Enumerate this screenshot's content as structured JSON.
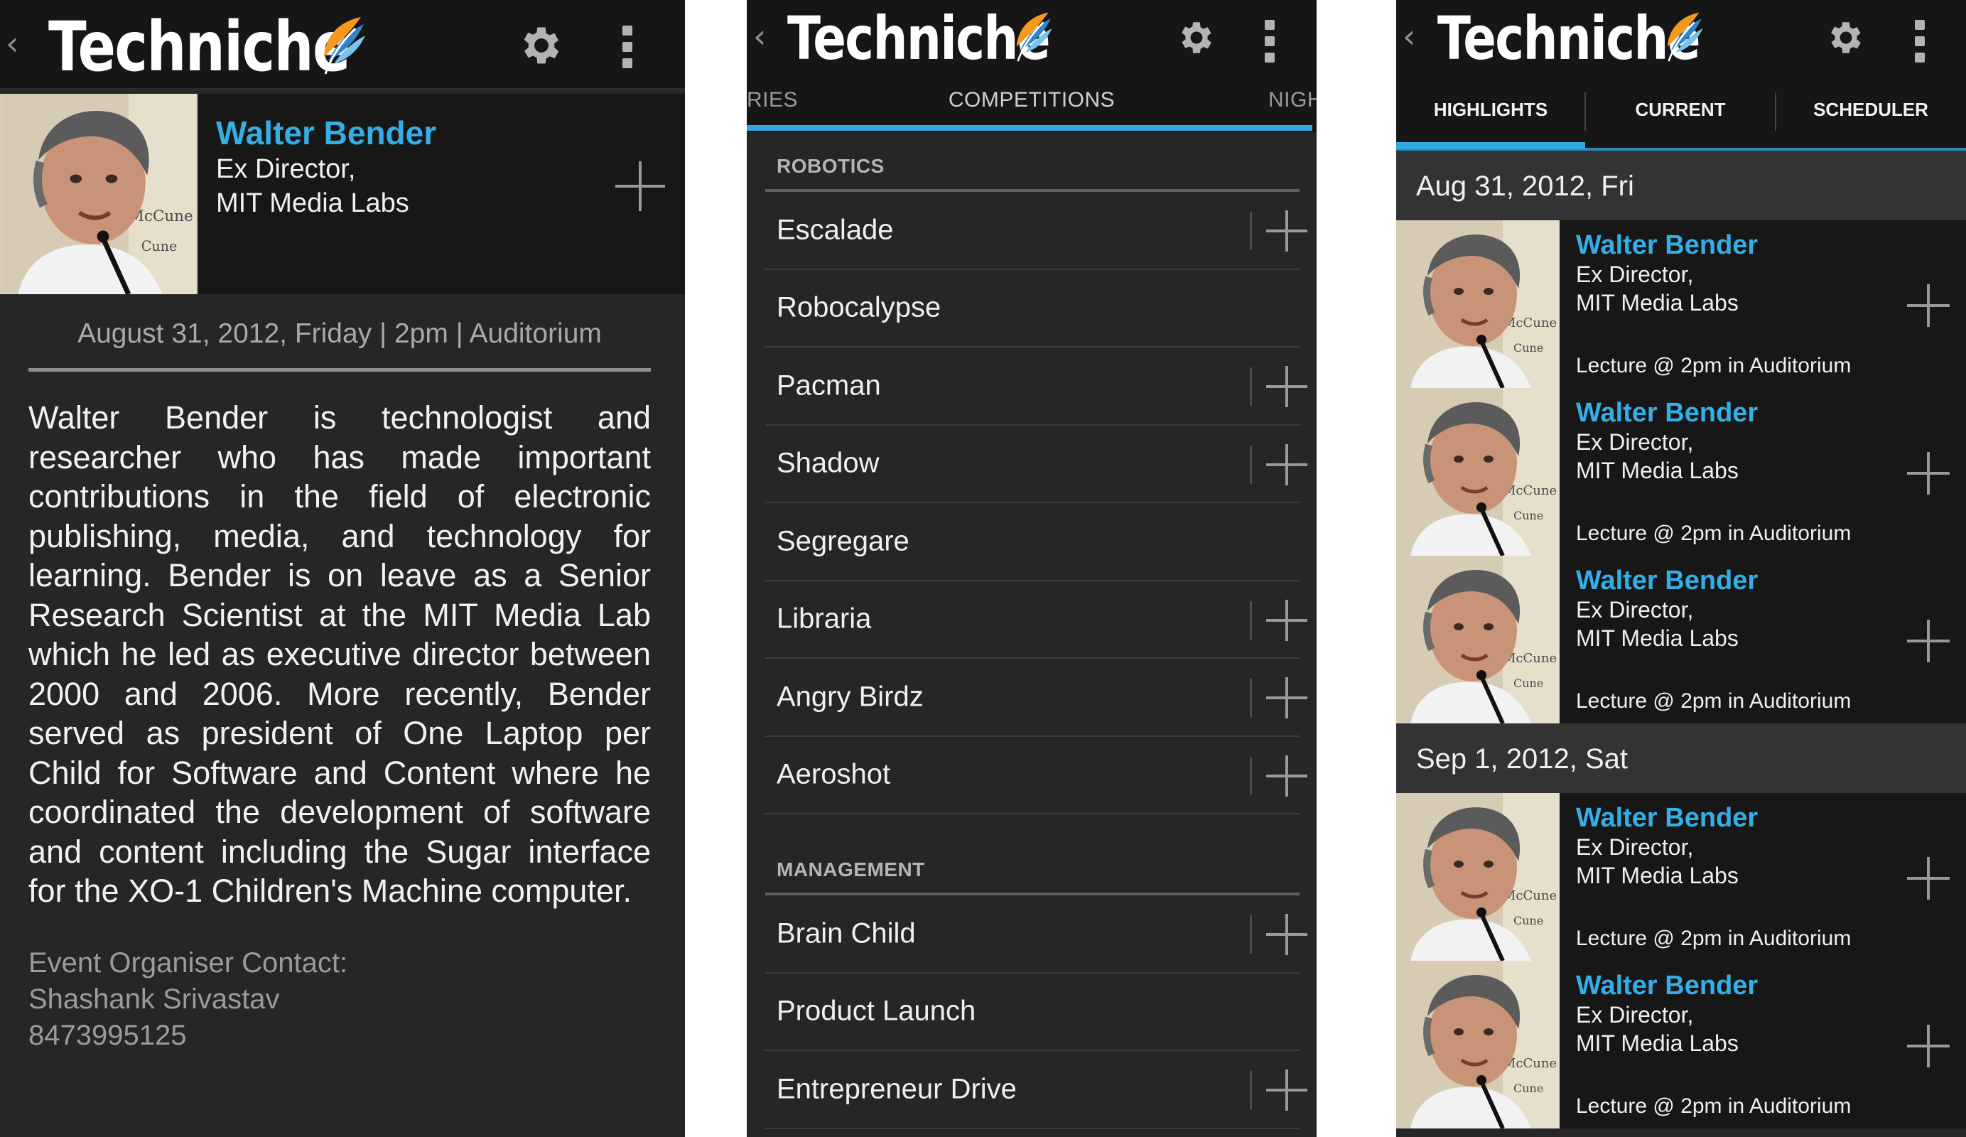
{
  "app": {
    "brand": "Techniche",
    "back_glyph": "‹"
  },
  "detail": {
    "speaker": {
      "name": "Walter Bender",
      "role_line1": "Ex Director,",
      "role_line2": "MIT Media Labs"
    },
    "event_line": "August 31, 2012, Friday | 2pm | Auditorium",
    "bio": "Walter Bender is technologist and researcher who has made important contributions in the field of electronic publishing, media, and technology for learning. Bender is on leave as a Senior Research Scientist at the MIT Media Lab which he led as executive director between 2000 and 2006. More recently, Bender served as president of One Laptop per Child for Software and Content where he coordinated the development of software and content including the Sugar interface for the XO-1 Children's Machine computer.",
    "contact": {
      "label": "Event Organiser Contact:",
      "name": "Shashank Srivastav",
      "phone": "8473995125"
    }
  },
  "competitions": {
    "tabs": {
      "left": "RIES",
      "center": "COMPETITIONS",
      "right": "NIGH"
    },
    "sections": [
      {
        "title": "ROBOTICS",
        "items": [
          {
            "label": "Escalade",
            "has_add": true
          },
          {
            "label": "Robocalypse",
            "has_add": false
          },
          {
            "label": "Pacman",
            "has_add": true
          },
          {
            "label": "Shadow",
            "has_add": true
          },
          {
            "label": "Segregare",
            "has_add": false
          },
          {
            "label": "Libraria",
            "has_add": true
          },
          {
            "label": "Angry Birdz",
            "has_add": true
          },
          {
            "label": "Aeroshot",
            "has_add": true
          }
        ]
      },
      {
        "title": "MANAGEMENT",
        "items": [
          {
            "label": "Brain Child",
            "has_add": true
          },
          {
            "label": "Product Launch",
            "has_add": false
          },
          {
            "label": "Entrepreneur Drive",
            "has_add": true
          }
        ]
      }
    ]
  },
  "schedule": {
    "tabs": [
      "HIGHLIGHTS",
      "CURRENT",
      "SCHEDULER"
    ],
    "days": [
      {
        "label": "Aug 31, 2012, Fri",
        "events": [
          {
            "name": "Walter Bender",
            "role_line1": "Ex Director,",
            "role_line2": "MIT Media Labs",
            "time": "Lecture @ 2pm in Auditorium"
          },
          {
            "name": "Walter Bender",
            "role_line1": "Ex Director,",
            "role_line2": "MIT Media Labs",
            "time": "Lecture @ 2pm in Auditorium"
          },
          {
            "name": "Walter Bender",
            "role_line1": "Ex Director,",
            "role_line2": "MIT Media Labs",
            "time": "Lecture @ 2pm in Auditorium"
          }
        ]
      },
      {
        "label": "Sep 1, 2012, Sat",
        "events": [
          {
            "name": "Walter Bender",
            "role_line1": "Ex Director,",
            "role_line2": "MIT Media Labs",
            "time": "Lecture @ 2pm in Auditorium"
          },
          {
            "name": "Walter Bender",
            "role_line1": "Ex Director,",
            "role_line2": "MIT Media Labs",
            "time": "Lecture @ 2pm in Auditorium"
          }
        ]
      }
    ]
  },
  "icons": {
    "back": "back-caret-icon",
    "logo": "feather-logo-icon",
    "settings": "gear-icon",
    "overflow": "overflow-menu-icon",
    "add": "plus-icon"
  },
  "colors": {
    "accent": "#30a9e2",
    "name": "#35aee6",
    "background": "#262626",
    "bar": "#161616"
  }
}
